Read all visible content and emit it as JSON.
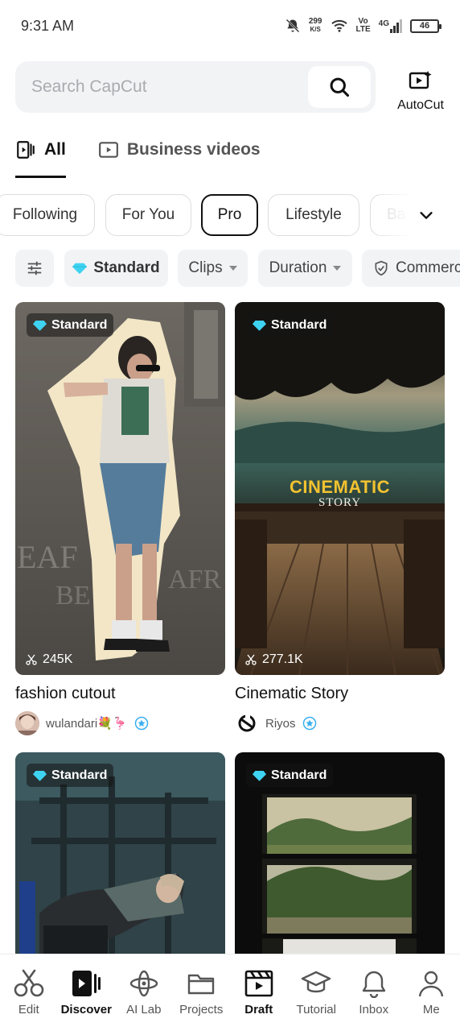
{
  "status_bar": {
    "time": "9:31 AM",
    "net_speed_value": "299",
    "net_speed_unit": "K/S",
    "volte_top": "Vo",
    "volte_bottom": "LTE",
    "network": "4G",
    "battery": "46"
  },
  "search": {
    "placeholder": "Search CapCut",
    "autocut_label": "AutoCut"
  },
  "top_tabs": [
    {
      "label": "All",
      "active": true
    },
    {
      "label": "Business videos",
      "active": false
    }
  ],
  "categories": [
    {
      "label": "Following"
    },
    {
      "label": "For You"
    },
    {
      "label": "Pro",
      "active": true
    },
    {
      "label": "Lifestyle"
    },
    {
      "label": "Ba"
    }
  ],
  "filters": {
    "standard": "Standard",
    "clips": "Clips",
    "duration": "Duration",
    "commercial": "Commerc"
  },
  "cards": [
    {
      "badge": "Standard",
      "uses": "245K",
      "title": "fashion cutout",
      "author": "wulandari💐🦩"
    },
    {
      "badge": "Standard",
      "uses": "277.1K",
      "title": "Cinematic Story",
      "author": "Riyos",
      "overlay_title": "CINEMATIC",
      "overlay_subtitle": "STORY"
    },
    {
      "badge": "Standard"
    },
    {
      "badge": "Standard"
    }
  ],
  "bottom_nav": [
    {
      "label": "Edit",
      "icon": "scissors-icon"
    },
    {
      "label": "Discover",
      "icon": "discover-icon",
      "active": true
    },
    {
      "label": "AI Lab",
      "icon": "ai-lab-icon"
    },
    {
      "label": "Projects",
      "icon": "folder-icon"
    },
    {
      "label": "Draft",
      "icon": "clapper-icon"
    },
    {
      "label": "Tutorial",
      "icon": "graduation-cap-icon"
    },
    {
      "label": "Inbox",
      "icon": "bell-icon"
    },
    {
      "label": "Me",
      "icon": "person-icon"
    }
  ],
  "colors": {
    "accent_diamond": "#3fd3f2",
    "cinematic_yellow": "#f2c230",
    "verified_blue": "#3ab0f0"
  }
}
